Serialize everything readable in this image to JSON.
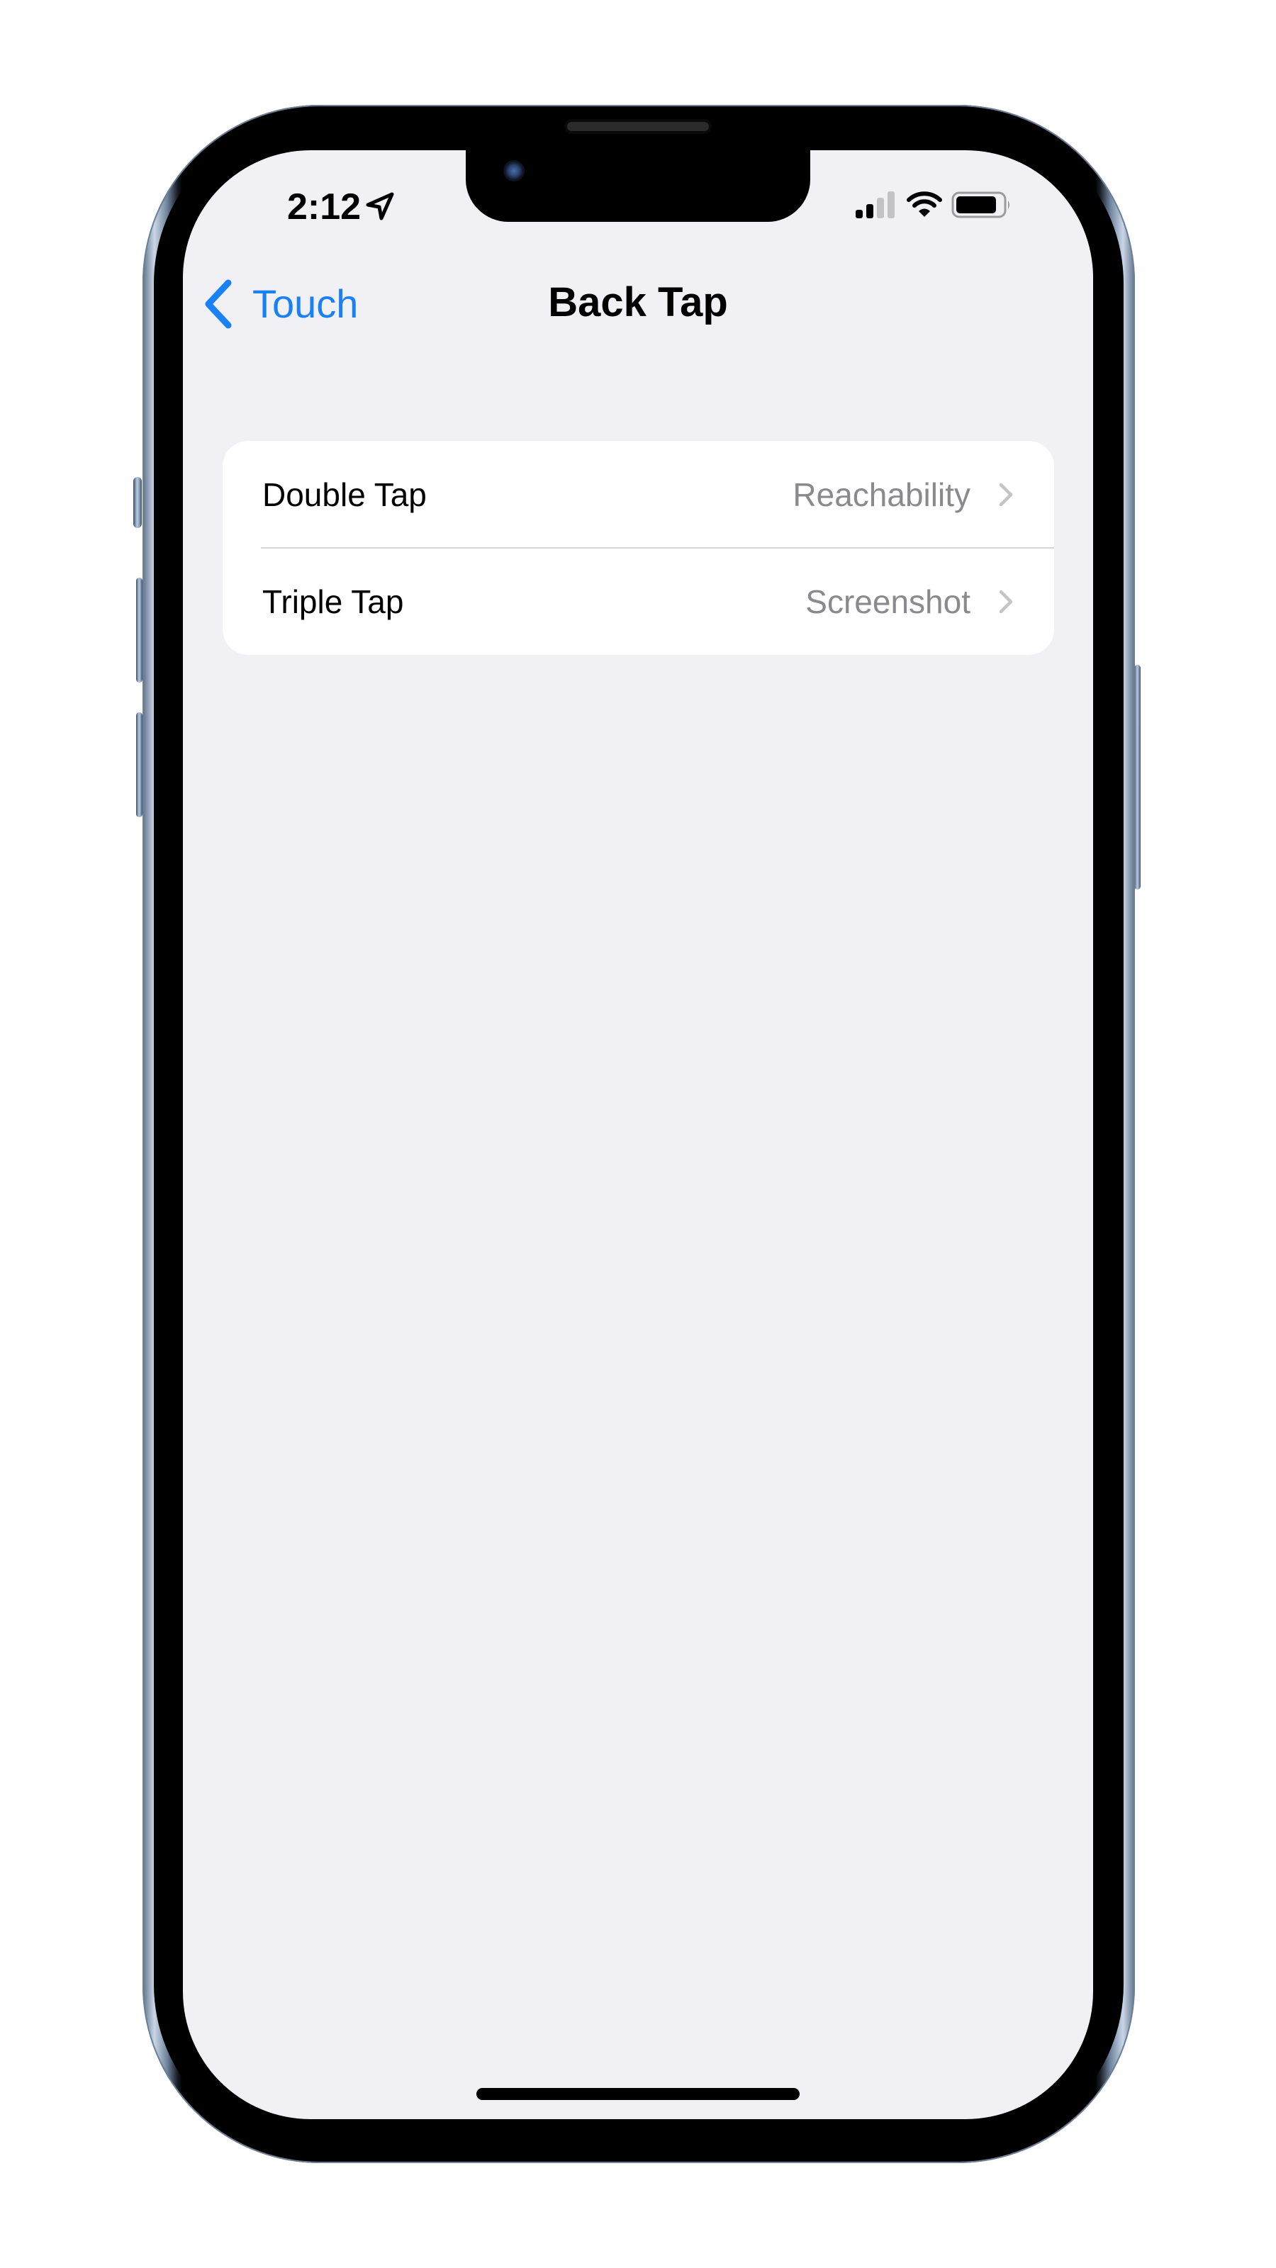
{
  "status_bar": {
    "time": "2:12",
    "location_icon": "location-arrow-icon",
    "signal_icon": "cellular-signal-icon",
    "signal_bars_filled": 2,
    "signal_bars_total": 4,
    "wifi_icon": "wifi-icon",
    "battery_icon": "battery-icon",
    "battery_level_percent": 85
  },
  "nav": {
    "back_label": "Touch",
    "back_icon": "chevron-left-icon",
    "title": "Back Tap"
  },
  "settings": {
    "rows": [
      {
        "label": "Double Tap",
        "value": "Reachability",
        "icon": "chevron-right-icon"
      },
      {
        "label": "Triple Tap",
        "value": "Screenshot",
        "icon": "chevron-right-icon"
      }
    ]
  },
  "colors": {
    "accent": "#1a80f5",
    "background": "#f0f0f5",
    "secondary_text": "#8a8a8e",
    "frame": "#6d7f97"
  }
}
